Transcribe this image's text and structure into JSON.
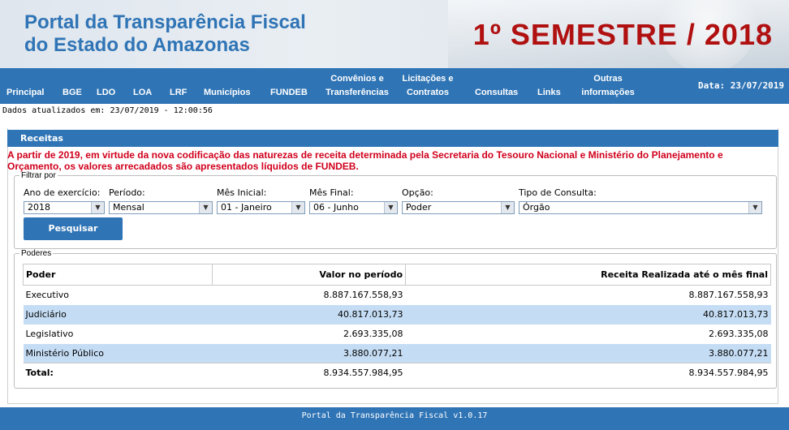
{
  "header": {
    "portal_title_line1": "Portal da Transparência Fiscal",
    "portal_title_line2": "do Estado do Amazonas",
    "semester": "1º SEMESTRE / 2018"
  },
  "nav": {
    "items": [
      {
        "l1": "Principal",
        "l2": ""
      },
      {
        "l1": "BGE",
        "l2": ""
      },
      {
        "l1": "LDO",
        "l2": ""
      },
      {
        "l1": "LOA",
        "l2": ""
      },
      {
        "l1": "LRF",
        "l2": ""
      },
      {
        "l1": "Municípios",
        "l2": ""
      },
      {
        "l1": "FUNDEB",
        "l2": ""
      },
      {
        "l1": "Convênios e",
        "l2": "Transferências"
      },
      {
        "l1": "Licitações e",
        "l2": "Contratos"
      },
      {
        "l1": "Consultas",
        "l2": ""
      },
      {
        "l1": "Links",
        "l2": ""
      },
      {
        "l1": "Outras",
        "l2": "informações"
      }
    ],
    "date": "Data: 23/07/2019"
  },
  "updated": "Dados atualizados em: 23/07/2019 - 12:00:56",
  "panel_title": "Receitas",
  "warning": "A partir de 2019, em virtude da nova codificação das naturezas de receita determinada pela Secretaria do Tesouro Nacional e Ministério do Planejamento e Orçamento, os valores arrecadados são apresentados líquidos de FUNDEB.",
  "filter": {
    "legend": "Filtrar por",
    "ano_label": "Ano de exercício:",
    "ano_value": "2018",
    "periodo_label": "Período:",
    "periodo_value": "Mensal",
    "mes_inicial_label": "Mês Inicial:",
    "mes_inicial_value": "01 - Janeiro",
    "mes_final_label": "Mês Final:",
    "mes_final_value": "06 - Junho",
    "opcao_label": "Opção:",
    "opcao_value": "Poder",
    "tipo_label": "Tipo de Consulta:",
    "tipo_value": "Órgão",
    "search_button": "Pesquisar"
  },
  "poderes": {
    "legend": "Poderes",
    "columns": [
      "Poder",
      "Valor no período",
      "Receita Realizada até o mês final"
    ],
    "rows": [
      {
        "poder": "Executivo",
        "valor": "8.887.167.558,93",
        "receita": "8.887.167.558,93"
      },
      {
        "poder": "Judiciário",
        "valor": "40.817.013,73",
        "receita": "40.817.013,73"
      },
      {
        "poder": "Legislativo",
        "valor": "2.693.335,08",
        "receita": "2.693.335,08"
      },
      {
        "poder": "Ministério Público",
        "valor": "3.880.077,21",
        "receita": "3.880.077,21"
      }
    ],
    "total": {
      "poder": "Total:",
      "valor": "8.934.557.984,95",
      "receita": "8.934.557.984,95"
    }
  },
  "footer": "Portal da Transparência Fiscal v1.0.17"
}
